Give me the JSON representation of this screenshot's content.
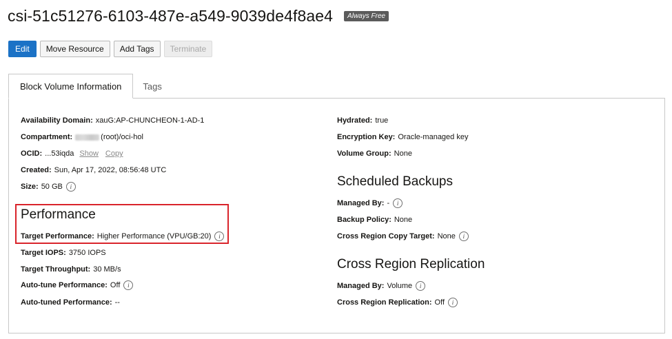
{
  "header": {
    "title": "csi-51c51276-6103-487e-a549-9039de4f8ae4",
    "badge": "Always Free"
  },
  "actions": {
    "edit": "Edit",
    "move": "Move Resource",
    "add_tags": "Add Tags",
    "terminate": "Terminate"
  },
  "tabs": [
    "Block Volume Information",
    "Tags"
  ],
  "info_left": {
    "availability_domain": {
      "label": "Availability Domain:",
      "value": "xauG:AP-CHUNCHEON-1-AD-1"
    },
    "compartment": {
      "label": "Compartment:",
      "value": "(root)/oci-hol"
    },
    "ocid": {
      "label": "OCID:",
      "value": "...53iqda",
      "show": "Show",
      "copy": "Copy"
    },
    "created": {
      "label": "Created:",
      "value": "Sun, Apr 17, 2022, 08:56:48 UTC"
    },
    "size": {
      "label": "Size:",
      "value": "50 GB"
    }
  },
  "performance": {
    "title": "Performance",
    "target_performance": {
      "label": "Target Performance:",
      "value": "Higher Performance (VPU/GB:20)"
    },
    "target_iops": {
      "label": "Target IOPS:",
      "value": "3750 IOPS"
    },
    "target_throughput": {
      "label": "Target Throughput:",
      "value": "30 MB/s"
    },
    "auto_tune": {
      "label": "Auto-tune Performance:",
      "value": "Off"
    },
    "auto_tuned": {
      "label": "Auto-tuned Performance:",
      "value": "--"
    }
  },
  "info_right": {
    "hydrated": {
      "label": "Hydrated:",
      "value": "true"
    },
    "encryption_key": {
      "label": "Encryption Key:",
      "value": "Oracle-managed key"
    },
    "volume_group": {
      "label": "Volume Group:",
      "value": "None"
    }
  },
  "scheduled_backups": {
    "title": "Scheduled Backups",
    "managed_by": {
      "label": "Managed By:",
      "value": "-"
    },
    "backup_policy": {
      "label": "Backup Policy:",
      "value": "None"
    },
    "cross_region_copy_target": {
      "label": "Cross Region Copy Target:",
      "value": "None"
    }
  },
  "cross_region_replication": {
    "title": "Cross Region Replication",
    "managed_by": {
      "label": "Managed By:",
      "value": "Volume"
    },
    "replication": {
      "label": "Cross Region Replication:",
      "value": "Off"
    }
  },
  "colors": {
    "primary": "#1b72c6",
    "highlight": "#d9232a",
    "badge_bg": "#5b5b5b"
  },
  "icons": {
    "info": "info-icon",
    "blurred": "redacted-tenancy"
  }
}
